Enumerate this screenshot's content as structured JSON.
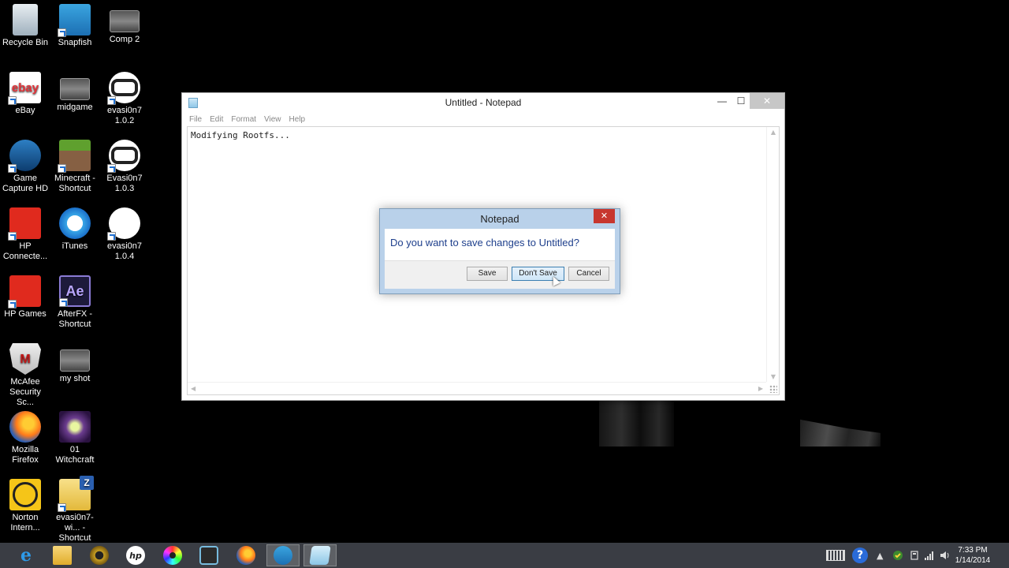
{
  "desktop": {
    "icons": [
      {
        "label": "Recycle Bin",
        "icon": "recycle-bin-icon"
      },
      {
        "label": "Snapfish",
        "icon": "snapfish-icon"
      },
      {
        "label": "Comp 2",
        "icon": "video-thumbnail-icon"
      },
      {
        "label": "eBay",
        "icon": "ebay-icon",
        "glyph": "ebay"
      },
      {
        "label": "midgame",
        "icon": "video-thumbnail-icon"
      },
      {
        "label": "evasi0n7 1.0.2",
        "icon": "evasi0n-icon"
      },
      {
        "label": "Game Capture HD",
        "icon": "game-capture-icon"
      },
      {
        "label": "Minecraft - Shortcut",
        "icon": "minecraft-icon"
      },
      {
        "label": "Evasi0n7 1.0.3",
        "icon": "evasi0n-icon"
      },
      {
        "label": "HP Connecte...",
        "icon": "hp-connected-icon"
      },
      {
        "label": "iTunes",
        "icon": "itunes-icon"
      },
      {
        "label": "evasi0n7 1.0.4",
        "icon": "evasi0n-icon"
      },
      {
        "label": "HP Games",
        "icon": "hp-games-icon"
      },
      {
        "label": "AfterFX - Shortcut",
        "icon": "after-effects-icon",
        "glyph": "Ae"
      },
      {
        "label": "McAfee Security Sc...",
        "icon": "mcafee-icon",
        "glyph": "M"
      },
      {
        "label": "my shot",
        "icon": "video-thumbnail-icon"
      },
      {
        "label": "Mozilla Firefox",
        "icon": "firefox-icon"
      },
      {
        "label": "01 Witchcraft",
        "icon": "witchcraft-icon"
      },
      {
        "label": "Norton Intern...",
        "icon": "norton-icon"
      },
      {
        "label": "evasi0n7-wi... - Shortcut",
        "icon": "zip-archive-icon"
      }
    ]
  },
  "notepad": {
    "title": "Untitled - Notepad",
    "controls": {
      "minimize": "—",
      "maximize": "☐",
      "close": "✕"
    },
    "menu": [
      "File",
      "Edit",
      "Format",
      "View",
      "Help"
    ],
    "content": "Modifying Rootfs...",
    "scroll_arrows": {
      "up": "▲",
      "down": "▼",
      "left": "◀",
      "right": "▶"
    }
  },
  "dialog": {
    "title": "Notepad",
    "close": "✕",
    "message": "Do you want to save changes to Untitled?",
    "buttons": {
      "save": "Save",
      "dont_save": "Don't Save",
      "cancel": "Cancel"
    }
  },
  "taskbar": {
    "apps": [
      {
        "name": "internet-explorer-icon",
        "glyph": "e"
      },
      {
        "name": "file-explorer-icon",
        "glyph": ""
      },
      {
        "name": "gold-app-icon",
        "glyph": ""
      },
      {
        "name": "hp-icon",
        "glyph": "hp"
      },
      {
        "name": "color-disc-icon",
        "glyph": ""
      },
      {
        "name": "video-editor-icon",
        "glyph": ""
      },
      {
        "name": "firefox-icon",
        "glyph": ""
      },
      {
        "name": "game-capture-icon",
        "glyph": ""
      },
      {
        "name": "notepad-icon",
        "glyph": ""
      }
    ],
    "tray": {
      "help_glyph": "?",
      "chevron": "▲",
      "clock_time": "7:33 PM",
      "clock_date": "1/14/2014"
    }
  },
  "colors": {
    "desktop_bg": "#000000",
    "taskbar_bg": "#3a3d44",
    "dialog_frame": "#b9d1ea",
    "dialog_message": "#1e3f8c",
    "close_red": "#c7372f"
  }
}
